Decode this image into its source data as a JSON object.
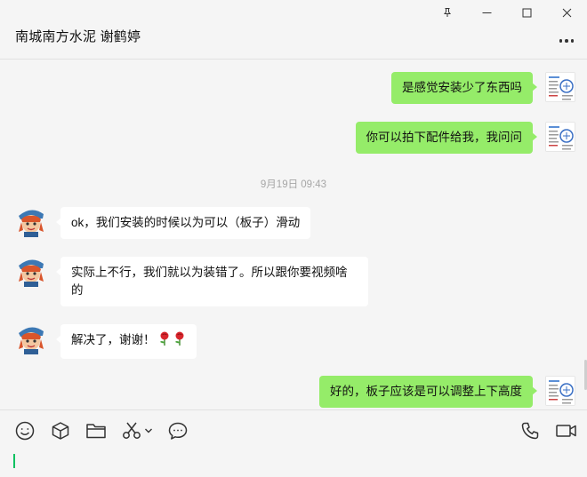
{
  "window": {
    "pin_label": "pin",
    "minimize_label": "minimize",
    "maximize_label": "maximize",
    "close_label": "close"
  },
  "header": {
    "title": "南城南方水泥 谢鹤婷",
    "more_icon": "more-icon"
  },
  "messages": [
    {
      "sender": "self",
      "text": "是感觉安装少了东西吗"
    },
    {
      "sender": "self",
      "text": "你可以拍下配件给我，我问问"
    },
    {
      "type": "time",
      "text": "9月19日 09:43"
    },
    {
      "sender": "contact",
      "text": "ok，我们安装的时候以为可以（板子）滑动"
    },
    {
      "sender": "contact",
      "text": "实际上不行，我们就以为装错了。所以跟你要视频啥的"
    },
    {
      "sender": "contact",
      "text": "解决了，谢谢！",
      "emoji": [
        "rose-icon",
        "rose-icon"
      ]
    },
    {
      "sender": "self",
      "text": "好的，板子应该是可以调整上下高度"
    }
  ],
  "toolbar": {
    "tools": [
      "emoji-icon",
      "sticker-box-icon",
      "folder-icon",
      "scissors-icon",
      "chevron-down-icon",
      "chat-history-icon",
      "phone-icon",
      "video-call-icon"
    ]
  },
  "colors": {
    "my_bubble": "#95ec69",
    "their_bubble": "#ffffff",
    "background": "#f5f5f5",
    "caret": "#07c160"
  }
}
